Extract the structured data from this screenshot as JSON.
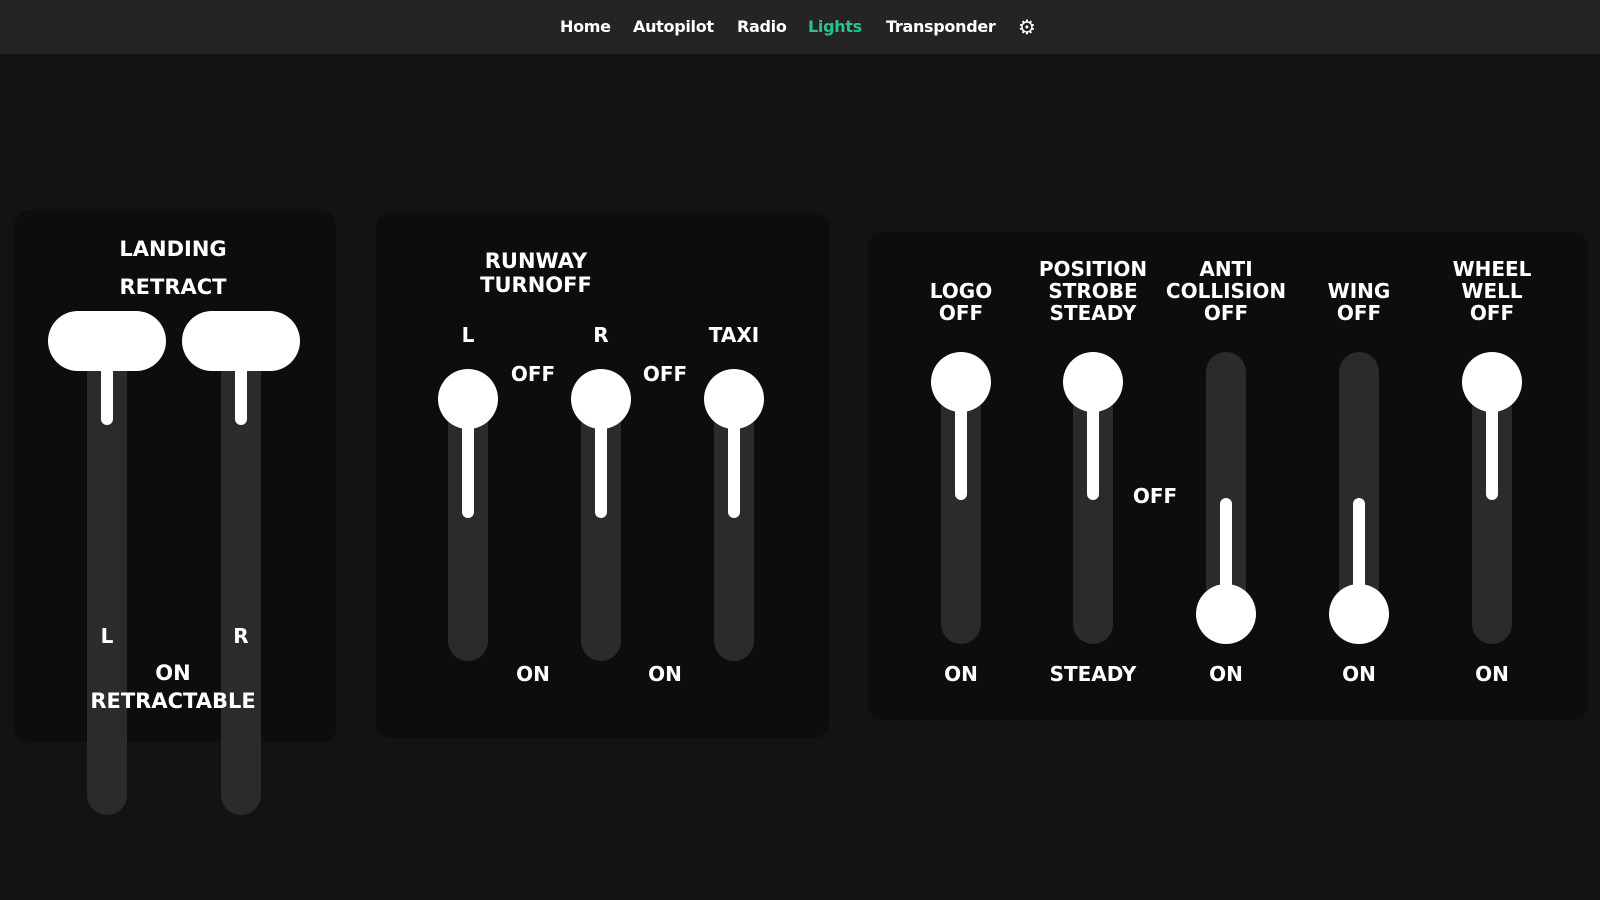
{
  "nav": {
    "items": [
      "Home",
      "Autopilot",
      "Radio",
      "Lights",
      "Transponder"
    ],
    "active": "Lights",
    "settings_icon": "gear-icon"
  },
  "colors": {
    "background": "#131313",
    "nav_background": "#242424",
    "panel_background": "#0d0d0d",
    "track": "#2b2b2b",
    "active_nav": "#27c58a"
  },
  "landing": {
    "top_line1": "LANDING",
    "top_line2": "RETRACT",
    "left_label": "L",
    "right_label": "R",
    "bottom_line1": "ON",
    "bottom_line2": "RETRACTABLE",
    "left_position": "RETRACT",
    "right_position": "RETRACT"
  },
  "runway": {
    "title_line1": "RUNWAY",
    "title_line2": "TURNOFF",
    "left_label": "L",
    "right_label": "R",
    "taxi_label": "TAXI",
    "off_left": "OFF",
    "off_right": "OFF",
    "on_left": "ON",
    "on_right": "ON"
  },
  "lights": {
    "logo": {
      "line1": "LOGO",
      "line2": "OFF",
      "bottom": "ON",
      "state": "OFF"
    },
    "position": {
      "line1": "POSITION",
      "line2": "STROBE",
      "line3": "STEADY",
      "mid": "OFF",
      "bottom": "STEADY",
      "state": "STROBE STEADY"
    },
    "anti_collision": {
      "line1": "ANTI",
      "line2": "COLLISION",
      "line3": "OFF",
      "bottom": "ON",
      "state": "ON"
    },
    "wing": {
      "line1": "WING",
      "line2": "OFF",
      "bottom": "ON",
      "state": "ON"
    },
    "wheel_well": {
      "line1": "WHEEL",
      "line2": "WELL",
      "line3": "OFF",
      "bottom": "ON",
      "state": "OFF"
    }
  }
}
